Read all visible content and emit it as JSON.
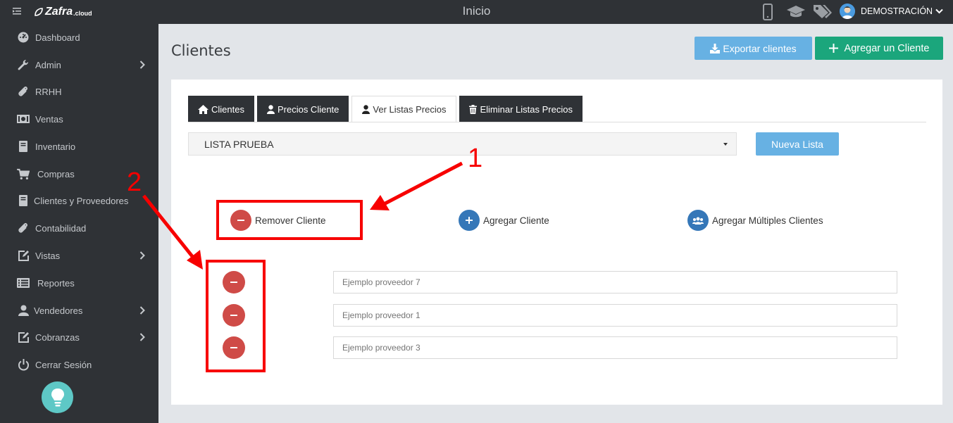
{
  "topbar": {
    "brand_name": "Zafra",
    "brand_tld": ".cloud",
    "page_heading": "Inicio",
    "user_name": "DEMOSTRACIÓN",
    "icons": [
      "mobile-icon",
      "graduation-cap-icon",
      "tags-icon",
      "avatar",
      "chevron-down-icon"
    ]
  },
  "sidebar": {
    "items": [
      {
        "label": "Dashboard",
        "icon": "dashboard-icon",
        "has_submenu": false
      },
      {
        "label": "Admin",
        "icon": "wrench-icon",
        "has_submenu": true
      },
      {
        "label": "RRHH",
        "icon": "paperclip-icon",
        "has_submenu": false
      },
      {
        "label": "Ventas",
        "icon": "money-icon",
        "has_submenu": false
      },
      {
        "label": "Inventario",
        "icon": "book-icon",
        "has_submenu": false
      },
      {
        "label": "Compras",
        "icon": "cart-icon",
        "has_submenu": false
      },
      {
        "label": "Clientes y Proveedores",
        "icon": "book-icon",
        "has_submenu": false
      },
      {
        "label": "Contabilidad",
        "icon": "paperclip-icon",
        "has_submenu": false
      },
      {
        "label": "Vistas",
        "icon": "edit-icon",
        "has_submenu": true
      },
      {
        "label": "Reportes",
        "icon": "list-icon",
        "has_submenu": false
      },
      {
        "label": "Vendedores",
        "icon": "user-icon",
        "has_submenu": true
      },
      {
        "label": "Cobranzas",
        "icon": "edit-icon",
        "has_submenu": true
      },
      {
        "label": "Cerrar Sesión",
        "icon": "power-icon",
        "has_submenu": false
      }
    ],
    "help_icon": "lightbulb-icon"
  },
  "header": {
    "title": "Clientes",
    "export_label": "Exportar clientes",
    "add_label": "Agregar un Cliente"
  },
  "tabs": [
    {
      "label": "Clientes",
      "icon": "home-icon",
      "active": false
    },
    {
      "label": "Precios Cliente",
      "icon": "user-icon",
      "active": false
    },
    {
      "label": "Ver Listas Precios",
      "icon": "user-icon",
      "active": true
    },
    {
      "label": "Eliminar Listas Precios",
      "icon": "trash-icon",
      "active": false
    }
  ],
  "list_select": {
    "value": "LISTA PRUEBA"
  },
  "nueva_lista_label": "Nueva Lista",
  "actions": {
    "remove_label": "Remover Cliente",
    "add_label": "Agregar Cliente",
    "add_multiple_label": "Agregar Múltiples Clientes"
  },
  "rows": [
    {
      "placeholder": "Ejemplo proveedor 7"
    },
    {
      "placeholder": "Ejemplo proveedor 1"
    },
    {
      "placeholder": "Ejemplo proveedor 3"
    }
  ],
  "annotations": {
    "marker_1": "1",
    "marker_2": "2",
    "color": "#f70000"
  },
  "colors": {
    "sidebar_bg": "#2f3236",
    "primary_light": "#67b1e3",
    "success": "#1ba67c",
    "danger": "#cf4b47",
    "info": "#3577b8"
  }
}
